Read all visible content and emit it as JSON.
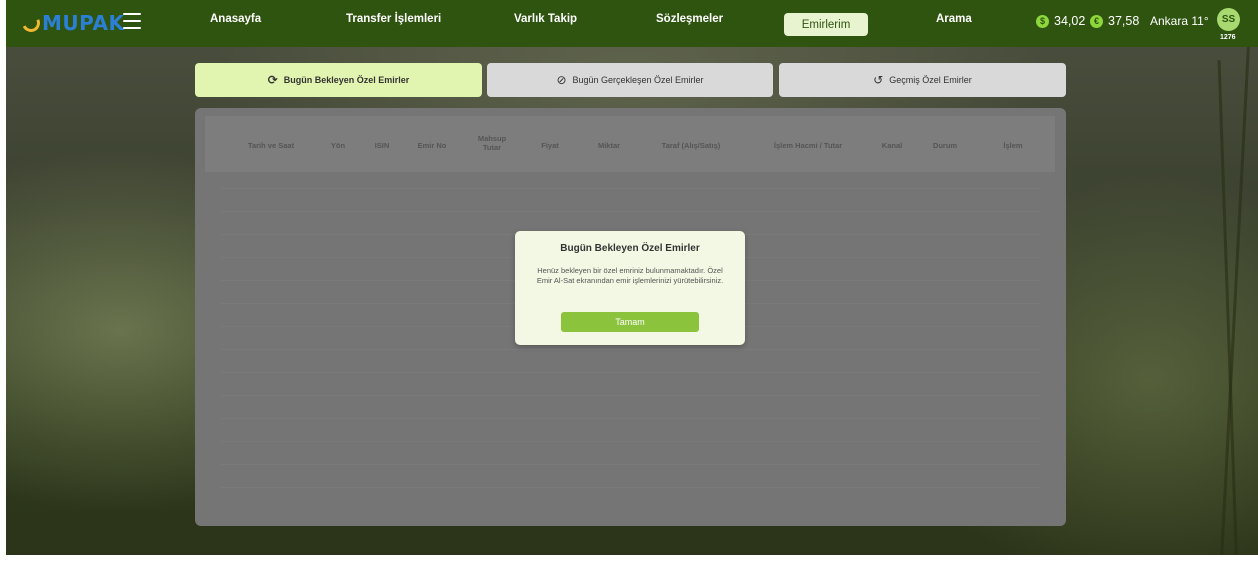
{
  "logo": {
    "text": "MUPAK"
  },
  "nav": {
    "items": [
      "Anasayfa",
      "Transfer İşlemleri",
      "Varlık Takip",
      "Sözleşmeler",
      "Emirlerim",
      "Arama"
    ]
  },
  "rates": [
    {
      "symbol": "$",
      "value": "34,02"
    },
    {
      "symbol": "€",
      "value": "37,58"
    }
  ],
  "weather": "Ankara 11°",
  "user": {
    "initials": "SS",
    "id": "1276"
  },
  "tabs": [
    {
      "label": "Bugün Bekleyen Özel Emirler",
      "icon": "refresh-icon"
    },
    {
      "label": "Bugün Gerçekleşen Özel Emirler",
      "icon": "check-circle-icon"
    },
    {
      "label": "Geçmiş Özel Emirler",
      "icon": "history-icon"
    }
  ],
  "table": {
    "columns": [
      "Tarih ve Saat",
      "Yön",
      "ISIN",
      "Emir No",
      "Mahsup Tutar",
      "Fiyat",
      "Miktar",
      "Taraf (Alış/Satış)",
      "İşlem Hacmi / Tutar",
      "Kanal",
      "Durum",
      "İşlem"
    ]
  },
  "modal": {
    "title": "Bugün Bekleyen Özel Emirler",
    "message": "Henüz bekleyen bir özel emriniz bulunmamaktadır. Özel Emir Al-Sat ekranından emir işlemlerinizi yürütebilirsiniz.",
    "button": "Tamam"
  },
  "colors": {
    "navbar": "#2f5410",
    "accent": "#8bc43c",
    "active_tab": "#e2f5b0"
  }
}
